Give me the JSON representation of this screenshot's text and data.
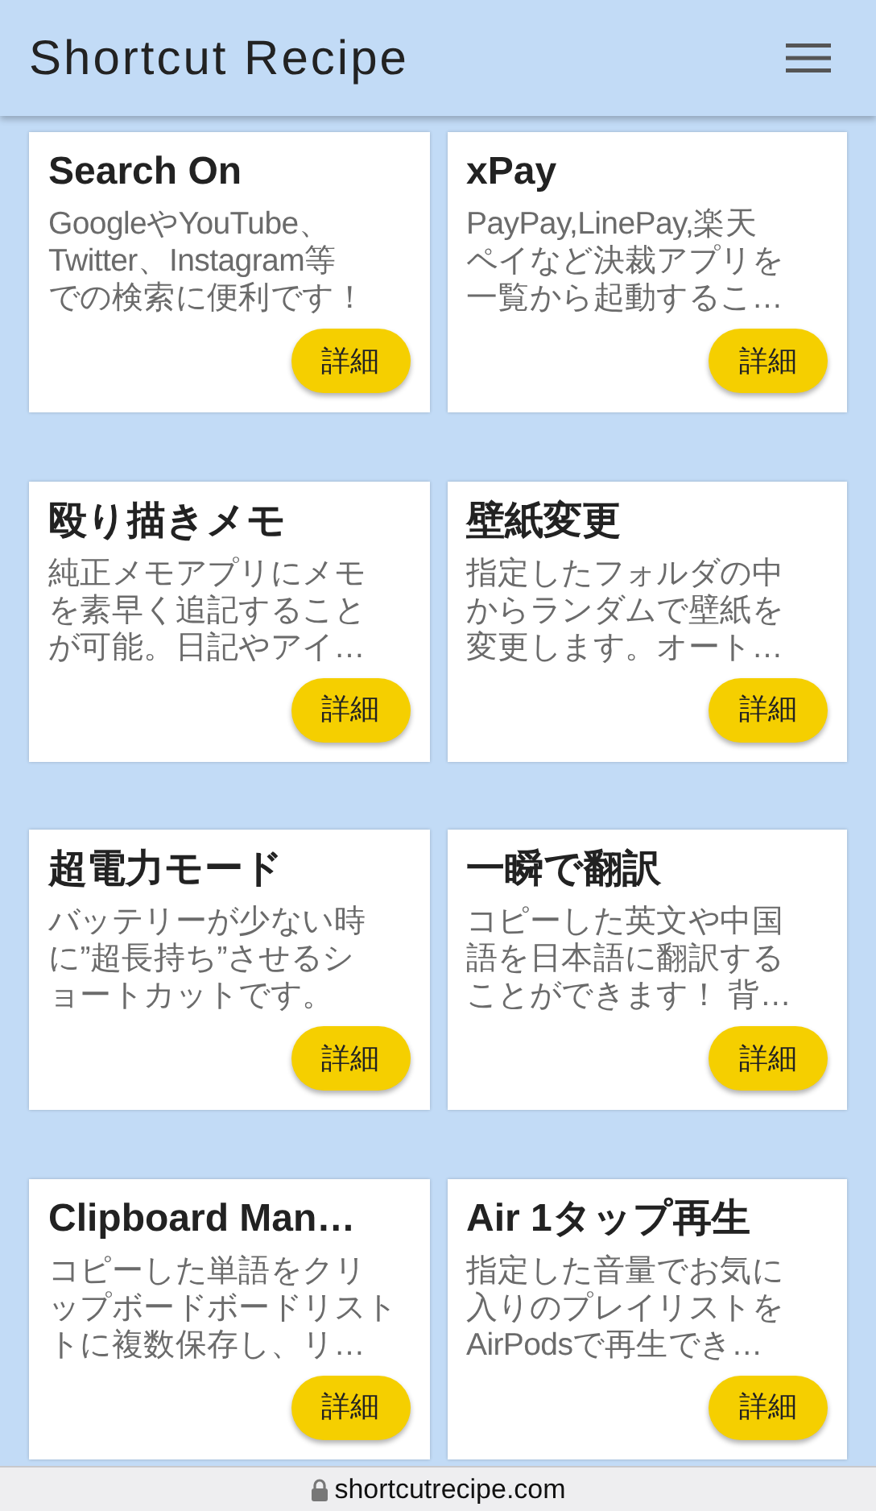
{
  "header": {
    "title": "Shortcut Recipe"
  },
  "cards": [
    {
      "title": "Search On",
      "description": [
        "GoogleやYouTube、",
        "Twitter、Instagram等",
        "での検索に便利です！"
      ],
      "button": "詳細"
    },
    {
      "title": "xPay",
      "description": [
        "PayPay,LinePay,楽天",
        "ペイなど決裁アプリを",
        "一覧から起動するこ…"
      ],
      "button": "詳細"
    },
    {
      "title": "殴り描きメモ",
      "description": [
        "純正メモアプリにメモ",
        "を素早く追記すること",
        "が可能。日記やアイ…"
      ],
      "button": "詳細"
    },
    {
      "title": "壁紙変更",
      "description": [
        "指定したフォルダの中",
        "からランダムで壁紙を",
        "変更します。オート…"
      ],
      "button": "詳細"
    },
    {
      "title": "超電力モード",
      "description": [
        "バッテリーが少ない時",
        "に”超長持ち”させるシ",
        "ョートカットです。"
      ],
      "button": "詳細"
    },
    {
      "title": "一瞬で翻訳",
      "description": [
        "コピーした英文や中国",
        "語を日本語に翻訳する",
        "ことができます！ 背…"
      ],
      "button": "詳細"
    },
    {
      "title": "Clipboard Man…",
      "description": [
        "コピーした単語をクリ",
        "ップボードボードリスト",
        "トに複数保存し、リ…"
      ],
      "button": "詳細"
    },
    {
      "title": "Air 1タップ再生",
      "description": [
        "指定した音量でお気に",
        "入りのプレイリストを",
        "AirPodsで再生でき…"
      ],
      "button": "詳細"
    }
  ],
  "address_bar": {
    "url": "shortcutrecipe.com"
  }
}
